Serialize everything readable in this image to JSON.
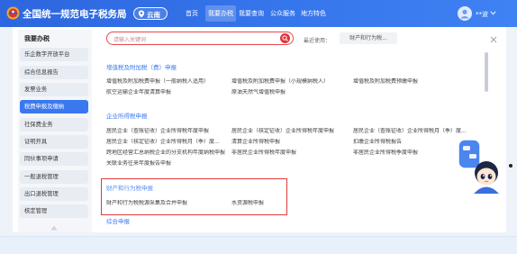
{
  "header": {
    "title": "全国统一规范电子税务局",
    "location": "云南",
    "nav": [
      {
        "label": "首页",
        "active": false
      },
      {
        "label": "我要办税",
        "active": true
      },
      {
        "label": "我要查询",
        "active": false
      },
      {
        "label": "公众服务",
        "active": false
      },
      {
        "label": "地方特色",
        "active": false
      }
    ],
    "user_name": "**波"
  },
  "sidebar": {
    "title": "我要办税",
    "selected_index": 3,
    "items": [
      "乐企数字开放平台",
      "综合信息报告",
      "发票业务",
      "税费申报及缴纳",
      "社保费业务",
      "证明开具",
      "同伙事项申请",
      "一般退税管理",
      "出口退税管理",
      "核定管理"
    ]
  },
  "toolbar": {
    "search_placeholder": "请输入关键词",
    "recent_label": "最近使用：",
    "recent_tags": [
      "财产和行为税..."
    ]
  },
  "sections": [
    {
      "title": "增值税及附加税（费）申报",
      "rows": [
        [
          "增值税及附加税费申报（一般纳税人适用）",
          "增值税及附加税费申报（小规模纳税人）",
          "增值税及附加税费预缴申报"
        ],
        [
          "航空运输企业年度清算申报",
          "原油天然气增值税申报"
        ]
      ]
    },
    {
      "title": "企业所得税申报",
      "rows": [
        [
          "居民企业（查账征收）企业所得税年度申报",
          "居民企业（核定征收）企业所得税年度申报",
          "居民企业（查账征收）企业所得税月（季）度..."
        ],
        [
          "居民企业（核定征收）企业所得税月（季）度...",
          "清算企业所得税申报",
          "扣缴企业所得税报告"
        ],
        [
          "跨地区经营汇总纳税企业的分支机构年度纳税申报",
          "非居民企业所得税年度申报",
          "非居民企业所得税季度申报"
        ],
        [
          "关联业务往来年度报告申报"
        ]
      ]
    },
    {
      "title": "财产和行为税申报",
      "highlighted": true,
      "rows": [
        [
          "财产和行为税税源采集及合并申报",
          "水资源税申报"
        ]
      ]
    },
    {
      "title": "综合申报",
      "rows": []
    }
  ],
  "colors": {
    "header_blue": "#3574ea",
    "accent": "#3a78f0",
    "search_red": "#e0363b",
    "highlight_border": "#e23a3a"
  },
  "icons": {
    "logo": "tax-emblem-logo",
    "location": "location-pin-icon",
    "avatar": "user-avatar-icon",
    "user_menu": "chevron-down-icon",
    "search": "search-icon",
    "close": "close-icon",
    "scroll_up": "triangle-up-icon",
    "assistant": "assistant-mascot"
  }
}
